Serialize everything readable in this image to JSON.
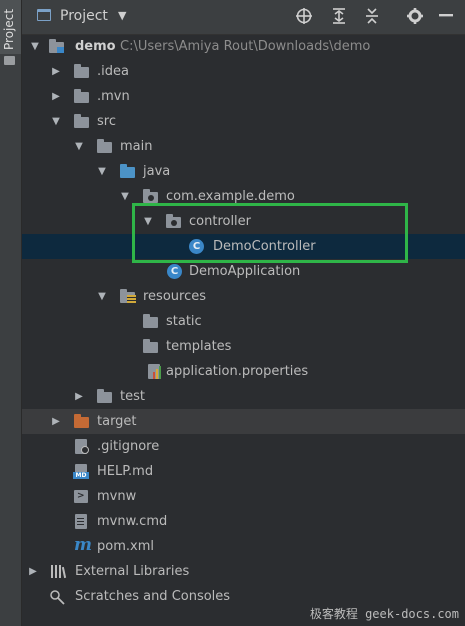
{
  "sidebar": {
    "tab_label": "Project"
  },
  "header": {
    "title": "Project",
    "dropdown_icon": "chevron-down",
    "buttons": [
      "locate-icon",
      "expand-all-icon",
      "collapse-all-icon",
      "settings-icon",
      "hide-icon"
    ]
  },
  "tree": {
    "root": {
      "name": "demo",
      "path": "C:\\Users\\Amiya Rout\\Downloads\\demo"
    },
    "idea": ".idea",
    "mvn": ".mvn",
    "src": "src",
    "main": "main",
    "java": "java",
    "package": "com.example.demo",
    "controller": "controller",
    "demo_controller": "DemoController",
    "demo_application": "DemoApplication",
    "resources": "resources",
    "static": "static",
    "templates": "templates",
    "application_properties": "application.properties",
    "test": "test",
    "target": "target",
    "gitignore": ".gitignore",
    "help": "HELP.md",
    "mvnw": "mvnw",
    "mvnw_cmd": "mvnw.cmd",
    "pom": "pom.xml",
    "external_libraries": "External Libraries",
    "scratches": "Scratches and Consoles"
  },
  "class_icon_letter": "C",
  "watermark": "极客教程 geek-docs.com",
  "colors": {
    "selection": "#0d293e",
    "highlight_box": "#2fb548",
    "source_folder": "#4c93c7",
    "excluded_folder": "#c46a35",
    "class_icon": "#3a87c8"
  }
}
